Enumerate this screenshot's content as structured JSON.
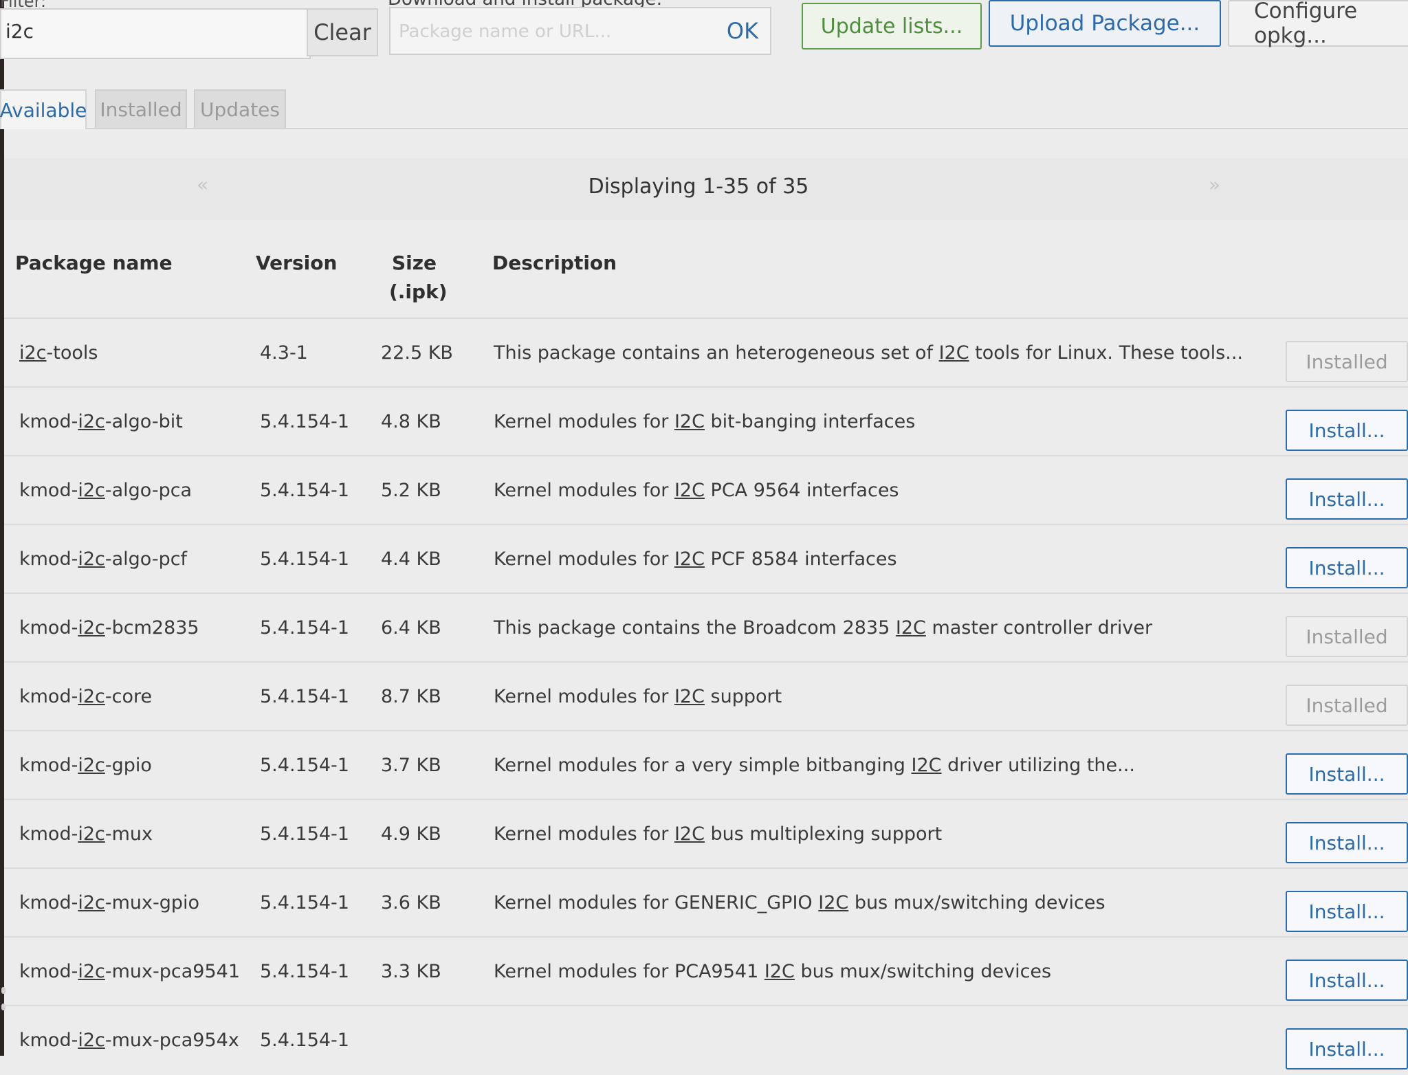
{
  "filter": {
    "label": "Filter:",
    "value": "i2c",
    "clear_label": "Clear"
  },
  "download": {
    "label": "Download and install package:",
    "placeholder": "Package name or URL...",
    "ok_label": "OK"
  },
  "toolbar": {
    "update_label": "Update lists...",
    "upload_label": "Upload Package...",
    "configure_label": "Configure opkg..."
  },
  "tabs": [
    {
      "label": "Available",
      "active": true
    },
    {
      "label": "Installed",
      "active": false
    },
    {
      "label": "Updates",
      "active": false
    }
  ],
  "pager": {
    "prev": "«",
    "text": "Displaying 1-35 of 35",
    "next": "»"
  },
  "table": {
    "headers": {
      "name": "Package name",
      "version": "Version",
      "size": "Size",
      "size_unit": "(.ipk)",
      "description": "Description"
    },
    "rows": [
      {
        "name_pre": "",
        "name_link": "i2c",
        "name_post": "-tools",
        "version": "4.3-1",
        "size": "22.5 KB",
        "desc_pre": "This package contains an heterogeneous set of ",
        "desc_link": "I2C",
        "desc_post": " tools for Linux. These tools...",
        "action": "Installed",
        "action_type": "installed"
      },
      {
        "name_pre": "kmod-",
        "name_link": "i2c",
        "name_post": "-algo-bit",
        "version": "5.4.154-1",
        "size": "4.8 KB",
        "desc_pre": "Kernel modules for ",
        "desc_link": "I2C",
        "desc_post": " bit-banging interfaces",
        "action": "Install...",
        "action_type": "install"
      },
      {
        "name_pre": "kmod-",
        "name_link": "i2c",
        "name_post": "-algo-pca",
        "version": "5.4.154-1",
        "size": "5.2 KB",
        "desc_pre": "Kernel modules for ",
        "desc_link": "I2C",
        "desc_post": " PCA 9564 interfaces",
        "action": "Install...",
        "action_type": "install"
      },
      {
        "name_pre": "kmod-",
        "name_link": "i2c",
        "name_post": "-algo-pcf",
        "version": "5.4.154-1",
        "size": "4.4 KB",
        "desc_pre": "Kernel modules for ",
        "desc_link": "I2C",
        "desc_post": " PCF 8584 interfaces",
        "action": "Install...",
        "action_type": "install"
      },
      {
        "name_pre": "kmod-",
        "name_link": "i2c",
        "name_post": "-bcm2835",
        "version": "5.4.154-1",
        "size": "6.4 KB",
        "desc_pre": "This package contains the Broadcom 2835 ",
        "desc_link": "I2C",
        "desc_post": " master controller driver",
        "action": "Installed",
        "action_type": "installed"
      },
      {
        "name_pre": "kmod-",
        "name_link": "i2c",
        "name_post": "-core",
        "version": "5.4.154-1",
        "size": "8.7 KB",
        "desc_pre": "Kernel modules for ",
        "desc_link": "I2C",
        "desc_post": " support",
        "action": "Installed",
        "action_type": "installed"
      },
      {
        "name_pre": "kmod-",
        "name_link": "i2c",
        "name_post": "-gpio",
        "version": "5.4.154-1",
        "size": "3.7 KB",
        "desc_pre": "Kernel modules for a very simple bitbanging ",
        "desc_link": "I2C",
        "desc_post": " driver utilizing the...",
        "action": "Install...",
        "action_type": "install"
      },
      {
        "name_pre": "kmod-",
        "name_link": "i2c",
        "name_post": "-mux",
        "version": "5.4.154-1",
        "size": "4.9 KB",
        "desc_pre": "Kernel modules for ",
        "desc_link": "I2C",
        "desc_post": " bus multiplexing support",
        "action": "Install...",
        "action_type": "install"
      },
      {
        "name_pre": "kmod-",
        "name_link": "i2c",
        "name_post": "-mux-gpio",
        "version": "5.4.154-1",
        "size": "3.6 KB",
        "desc_pre": "Kernel modules for GENERIC_GPIO ",
        "desc_link": "I2C",
        "desc_post": " bus mux/switching devices",
        "action": "Install...",
        "action_type": "install"
      },
      {
        "name_pre": "kmod-",
        "name_link": "i2c",
        "name_post": "-mux-pca9541",
        "version": "5.4.154-1",
        "size": "3.3 KB",
        "desc_pre": "Kernel modules for PCA9541 ",
        "desc_link": "I2C",
        "desc_post": " bus mux/switching devices",
        "action": "Install...",
        "action_type": "install"
      },
      {
        "name_pre": "kmod-",
        "name_link": "i2c",
        "name_post": "-mux-pca954x",
        "version": "5.4.154-1",
        "size": "",
        "desc_pre": "",
        "desc_link": "",
        "desc_post": "",
        "action": "Install...",
        "action_type": "install"
      }
    ]
  }
}
